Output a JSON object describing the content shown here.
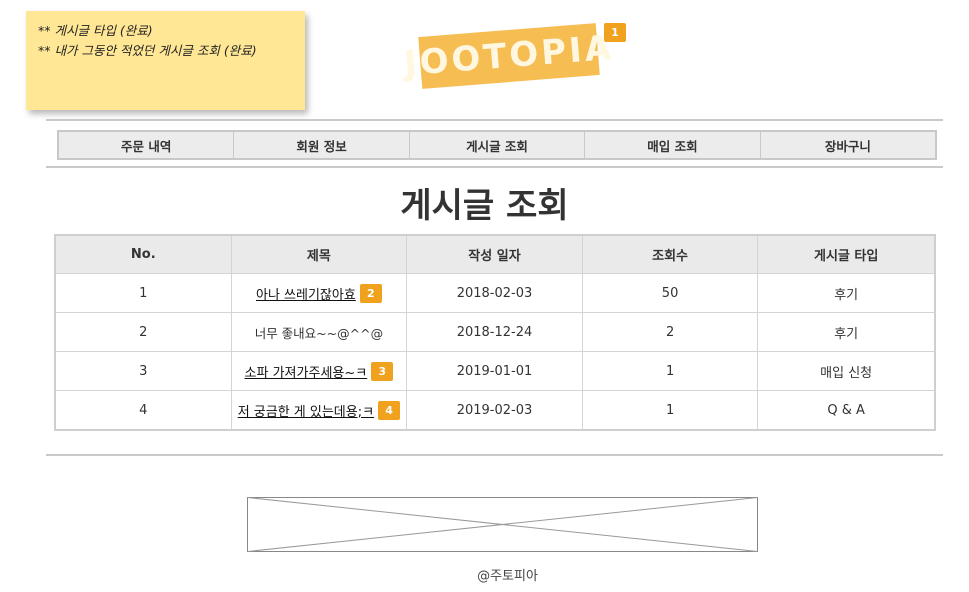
{
  "sticky_note": {
    "lines": [
      "** 게시글 타입 (완료)",
      "** 내가 그동안 적었던 게시글 조회 (완료)"
    ]
  },
  "logo": {
    "text": "JOOTOPIA",
    "color": "#f6bd52"
  },
  "badges": {
    "logo": "1"
  },
  "nav": {
    "items": [
      "주문 내역",
      "회원 정보",
      "게시글 조회",
      "매입 조회",
      "장바구니"
    ]
  },
  "page_title": "게시글 조회",
  "table": {
    "headers": [
      "No.",
      "제목",
      "작성 일자",
      "조회수",
      "게시글 타입"
    ],
    "rows": [
      {
        "no": "1",
        "title": "아나 쓰레기잖아효",
        "date": "2018-02-03",
        "views": "50",
        "type": "후기",
        "badge": "2"
      },
      {
        "no": "2",
        "title": "너무 좋내요~~@^^@",
        "date": "2018-12-24",
        "views": "2",
        "type": "후기",
        "badge": ""
      },
      {
        "no": "3",
        "title": "소파 가져가주세용~ㅋ",
        "date": "2019-01-01",
        "views": "1",
        "type": "매입 신청",
        "badge": "3"
      },
      {
        "no": "4",
        "title": "저 궁금한 게 있는데용;ㅋ",
        "date": "2019-02-03",
        "views": "1",
        "type": "Q & A",
        "badge": "4"
      }
    ]
  },
  "footer": {
    "text": "@주토피아"
  },
  "colors": {
    "badge": "#f0a21f",
    "sticky": "#ffe795",
    "accent": "#f6bd52"
  }
}
